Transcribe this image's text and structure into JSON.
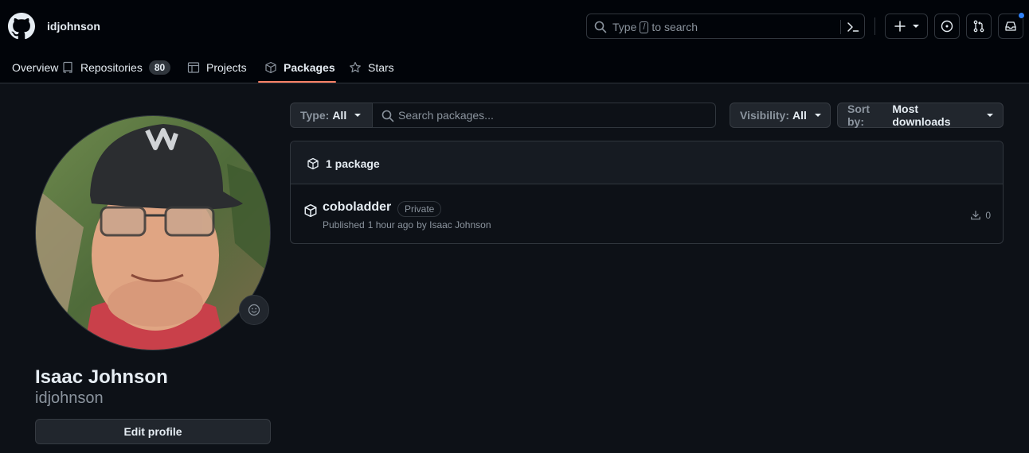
{
  "header": {
    "username": "idjohnson",
    "search": {
      "prefix": "Type",
      "key": "/",
      "suffix": "to search"
    }
  },
  "tabs": [
    {
      "label": "Overview"
    },
    {
      "label": "Repositories",
      "count": "80"
    },
    {
      "label": "Projects"
    },
    {
      "label": "Packages",
      "active": true
    },
    {
      "label": "Stars"
    }
  ],
  "profile": {
    "full_name": "Isaac Johnson",
    "login": "idjohnson",
    "edit_label": "Edit profile"
  },
  "filters": {
    "type_label": "Type:",
    "type_value": "All",
    "search_placeholder": "Search packages...",
    "visibility_label": "Visibility:",
    "visibility_value": "All",
    "sort_label": "Sort by:",
    "sort_value": "Most downloads"
  },
  "packages_panel": {
    "count_text": "1 package",
    "items": [
      {
        "name": "coboladder",
        "visibility": "Private",
        "published": "Published",
        "when": "1 hour ago",
        "by": "by Isaac Johnson",
        "downloads": "0"
      }
    ]
  },
  "colors": {
    "background": "#0d1117",
    "header_bg": "#010409",
    "accent_tab": "#f78166",
    "notification": "#2f81f7"
  }
}
